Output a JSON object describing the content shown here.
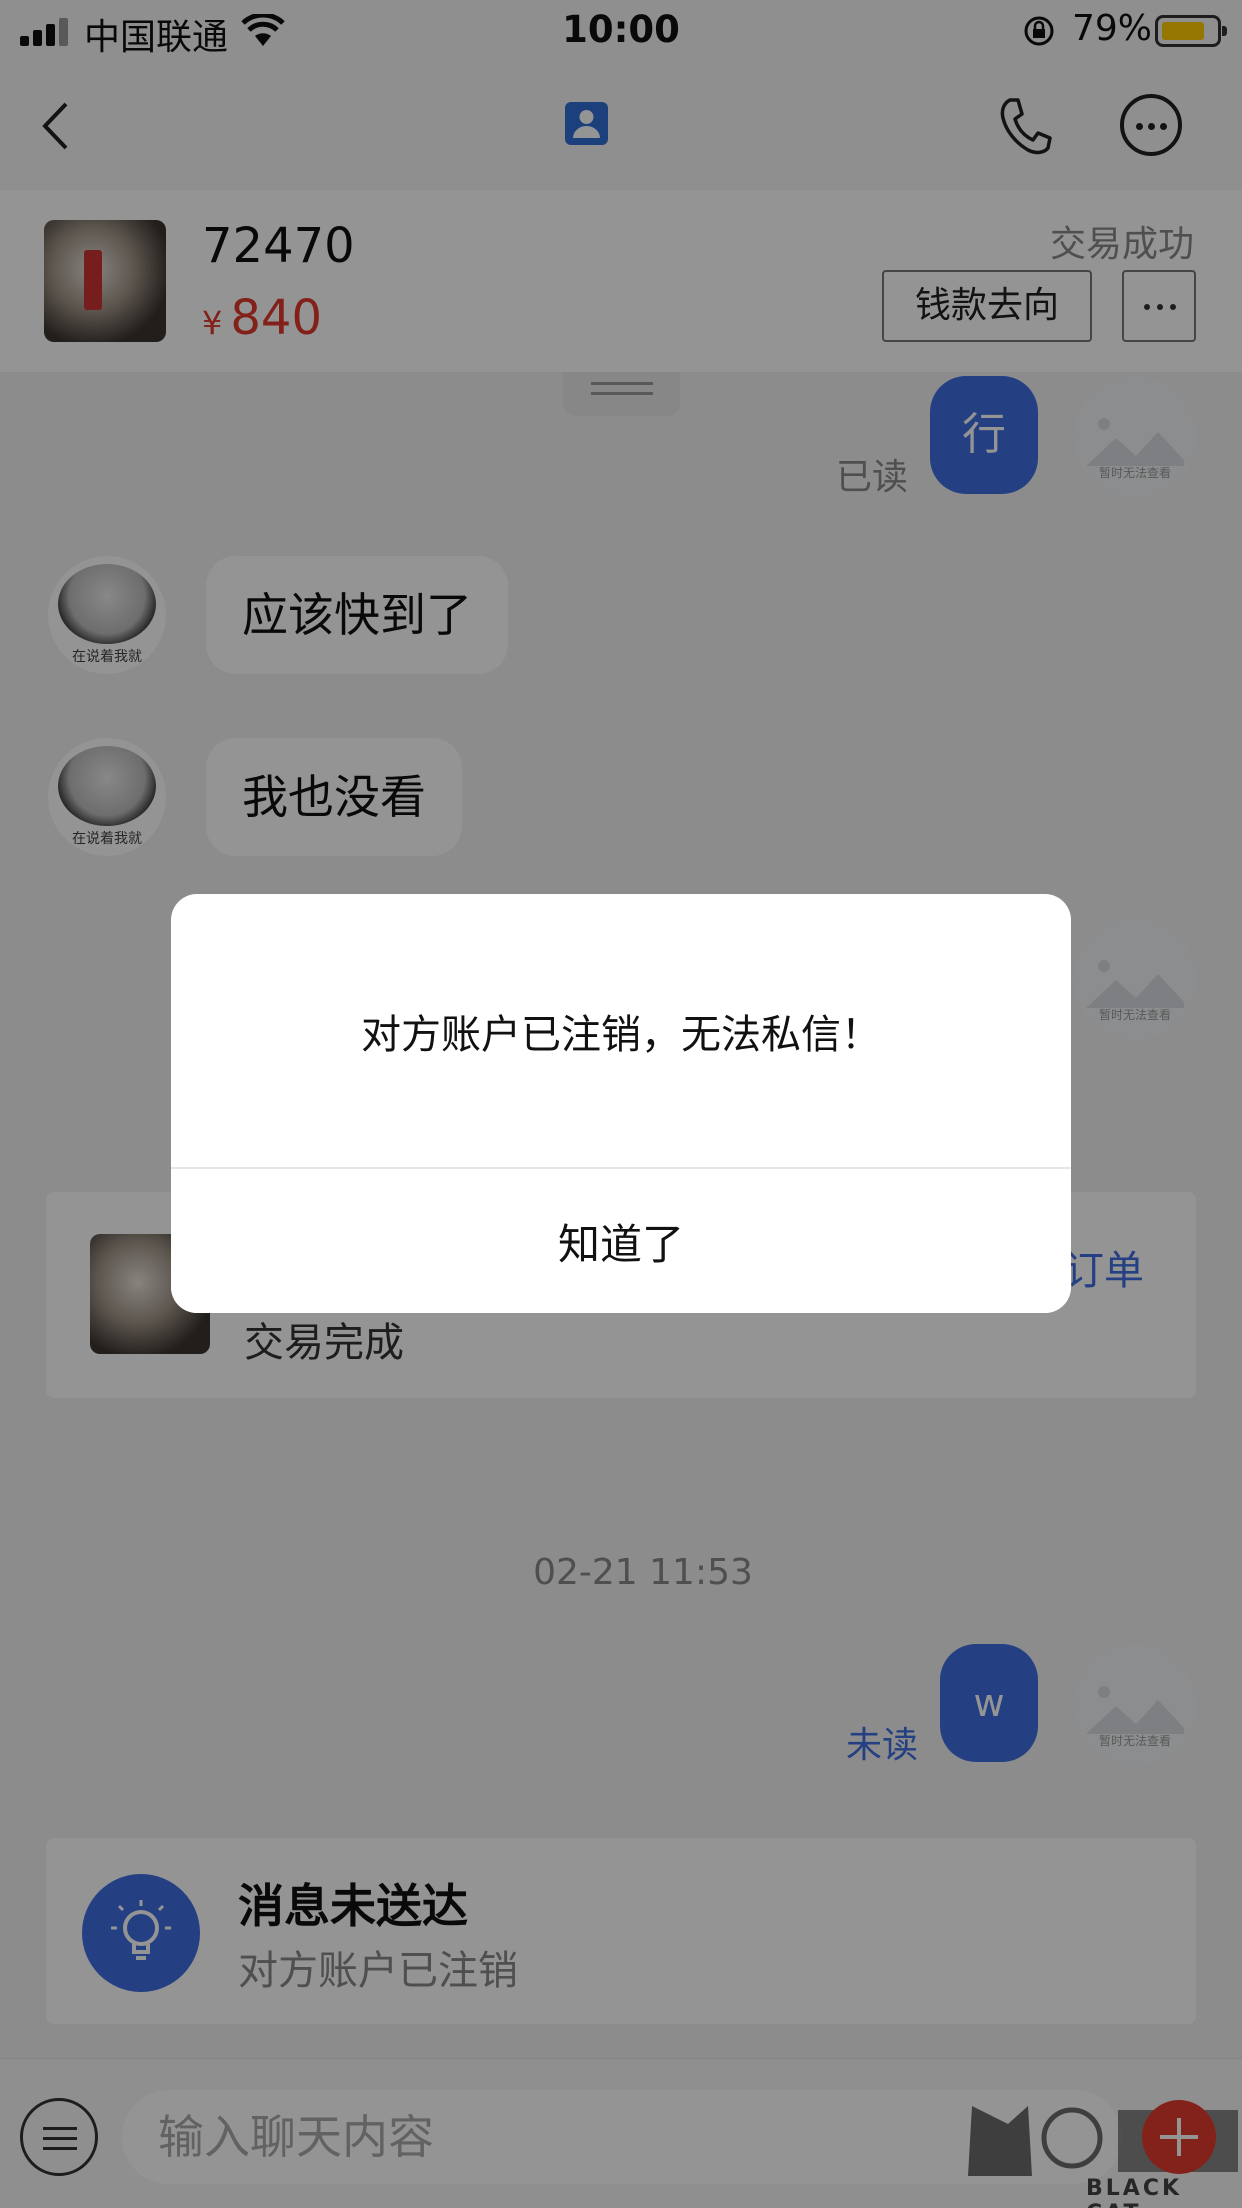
{
  "status_bar": {
    "carrier": "中国联通",
    "time": "10:00",
    "battery_pct": "79%",
    "icons": [
      "signal-icon",
      "wifi-icon",
      "orientation-lock-icon",
      "battery-icon"
    ]
  },
  "nav": {
    "icons": [
      "back-icon",
      "contact-icon",
      "phone-icon",
      "more-icon"
    ]
  },
  "product": {
    "title": "72470",
    "currency": "¥",
    "price": "840",
    "status": "交易成功",
    "money_button": "钱款去向"
  },
  "messages": {
    "m1": {
      "text": "行",
      "status": "已读"
    },
    "m2": {
      "text": "应该快到了",
      "avatar_caption": "在说着我就"
    },
    "m3": {
      "text": "我也没看",
      "avatar_caption": "在说着我就"
    },
    "m4": {
      "text": "w",
      "status": "未读"
    },
    "right_avatar_caption": "暂时无法查看"
  },
  "order": {
    "status": "交易完成",
    "link": "订单"
  },
  "timestamp": "02-21 11:53",
  "notice": {
    "title": "消息未送达",
    "subtitle": "对方账户已注销",
    "icon": "lightbulb-icon"
  },
  "input": {
    "placeholder": "输入聊天内容"
  },
  "watermark": {
    "text": "BLACK CAT"
  },
  "dialog": {
    "message": "对方账户已注销，无法私信！",
    "button": "知道了"
  },
  "colors": {
    "accent": "#3e6fe0",
    "price": "#e0392b",
    "battery": "#ffcc00"
  }
}
